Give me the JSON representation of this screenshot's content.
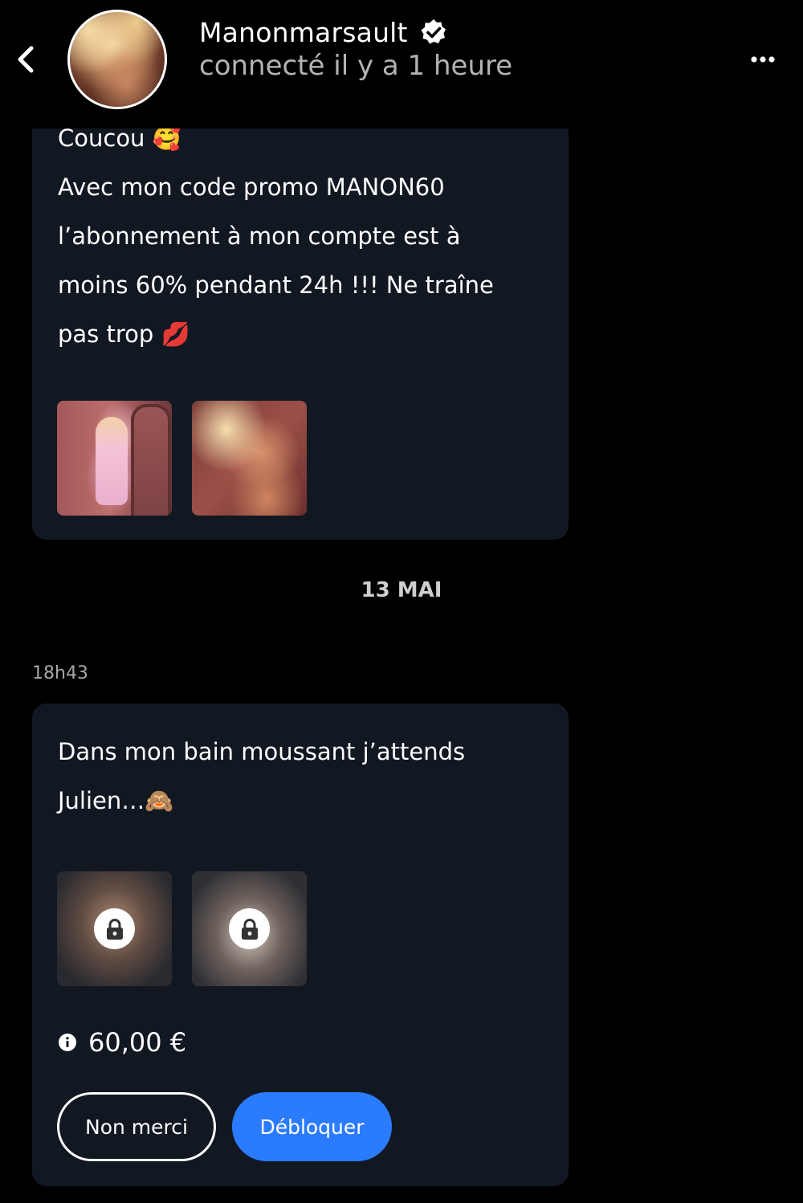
{
  "header": {
    "username": "Manonmarsault",
    "status": "connecté il y a 1 heure",
    "verified": true
  },
  "messages": [
    {
      "lines": [
        "Coucou 🥰",
        "Avec mon code promo MANON60",
        "l’abonnement à mon compte est à",
        "moins 60% pendant 24h !!! Ne traîne",
        "pas trop 💋"
      ],
      "media_count": 2,
      "locked": false
    },
    {
      "lines": [
        "Dans mon bain moussant j’attends",
        "Julien…🙈"
      ],
      "media_count": 2,
      "locked": true,
      "price": "60,00 €",
      "buttons": {
        "decline": "Non merci",
        "unlock": "Débloquer"
      }
    }
  ],
  "date_separator": "13 MAI",
  "timestamp": "18h43",
  "colors": {
    "background": "#000000",
    "bubble": "#121822",
    "accent": "#2b7bff",
    "muted_text": "#b3b3b3"
  },
  "icons": {
    "back": "chevron-left-icon",
    "verified": "verified-badge-icon",
    "more": "more-horizontal-icon",
    "lock": "lock-icon",
    "info": "info-icon"
  }
}
